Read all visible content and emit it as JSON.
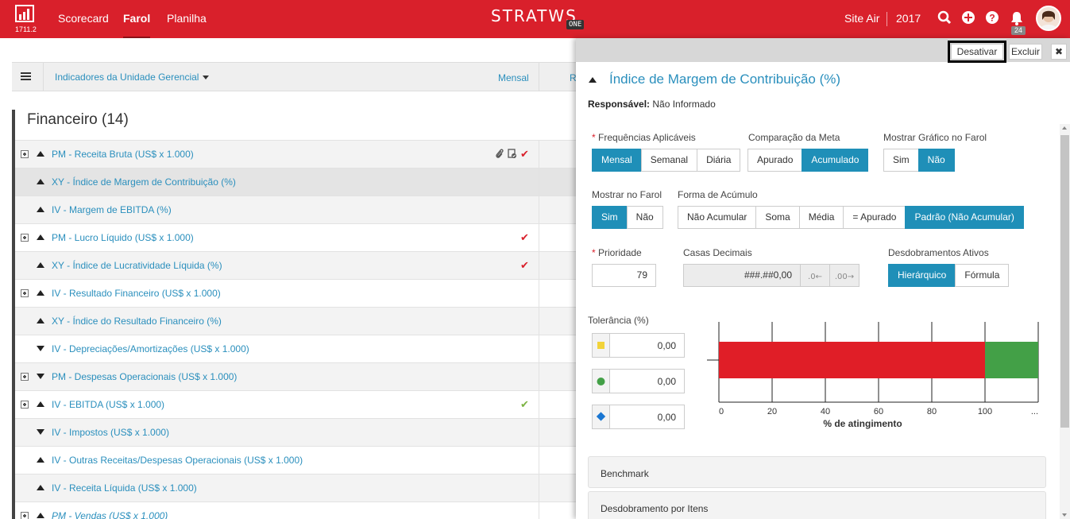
{
  "topbar": {
    "version": "1711.2",
    "nav": [
      "Scorecard",
      "Farol",
      "Planilha"
    ],
    "active_nav": "Farol",
    "brand": "STRATWS",
    "brand_suffix": "ONE",
    "company": "Site Air",
    "year": "2017",
    "notifications_count": "24",
    "icons": [
      "search-icon",
      "plus-circle-icon",
      "help-icon",
      "bell-icon"
    ]
  },
  "toolbar": {
    "title": "Indicadores da Unidade Gerencial",
    "frequency": "Mensal",
    "truncated_col": "R"
  },
  "group": {
    "title": "Financeiro (14)"
  },
  "rows": [
    {
      "label": "PM - Receita Bruta (US$ x 1.000)",
      "expand": true,
      "trend": "up",
      "check": "red",
      "icons": [
        "paperclip-icon",
        "document-check-icon"
      ]
    },
    {
      "label": "XY - Índice de Margem de Contribuição (%)",
      "expand": false,
      "trend": "up",
      "check": "",
      "selected": true
    },
    {
      "label": "IV - Margem de EBITDA (%)",
      "expand": false,
      "trend": "up",
      "check": ""
    },
    {
      "label": "PM - Lucro Líquido (US$ x 1.000)",
      "expand": true,
      "trend": "up",
      "check": "red"
    },
    {
      "label": "XY - Índice de Lucratividade Líquida (%)",
      "expand": false,
      "trend": "up",
      "check": "red"
    },
    {
      "label": "IV - Resultado Financeiro (US$ x 1.000)",
      "expand": true,
      "trend": "up",
      "check": ""
    },
    {
      "label": "XY - Índice do Resultado Financeiro (%)",
      "expand": false,
      "trend": "up",
      "check": ""
    },
    {
      "label": "IV - Depreciações/Amortizações (US$ x 1.000)",
      "expand": false,
      "trend": "down",
      "check": ""
    },
    {
      "label": "PM - Despesas Operacionais (US$ x 1.000)",
      "expand": true,
      "trend": "down",
      "check": ""
    },
    {
      "label": "IV - EBITDA (US$ x 1.000)",
      "expand": true,
      "trend": "up",
      "check": "green"
    },
    {
      "label": "IV - Impostos (US$ x 1.000)",
      "expand": false,
      "trend": "down",
      "check": ""
    },
    {
      "label": "IV - Outras Receitas/Despesas Operacionais (US$ x 1.000)",
      "expand": false,
      "trend": "up",
      "check": ""
    },
    {
      "label": "IV - Receita Líquida (US$ x 1.000)",
      "expand": false,
      "trend": "up",
      "check": ""
    },
    {
      "label": "PM - Vendas (US$ x 1.000)",
      "expand": true,
      "trend": "up",
      "check": "",
      "italic": true
    }
  ],
  "panel": {
    "buttons": {
      "deactivate": "Desativar",
      "delete": "Excluir",
      "close": "✖"
    },
    "title": "Índice de Margem de Contribuição (%)",
    "responsible_label": "Responsável:",
    "responsible_value": "Não Informado",
    "frequencies": {
      "label": "Frequências Aplicáveis",
      "required": "*",
      "options": [
        "Mensal",
        "Semanal",
        "Diária"
      ],
      "selected": "Mensal"
    },
    "goal_comparison": {
      "label": "Comparação da Meta",
      "options": [
        "Apurado",
        "Acumulado"
      ],
      "selected": "Acumulado"
    },
    "show_chart": {
      "label": "Mostrar Gráfico no Farol",
      "options": [
        "Sim",
        "Não"
      ],
      "selected": "Não"
    },
    "show_in_farol": {
      "label": "Mostrar no Farol",
      "options": [
        "Sim",
        "Não"
      ],
      "selected": "Sim"
    },
    "accumulation": {
      "label": "Forma de Acúmulo",
      "options": [
        "Não Acumular",
        "Soma",
        "Média",
        "= Apurado",
        "Padrão (Não Acumular)"
      ],
      "selected": "Padrão (Não Acumular)"
    },
    "priority": {
      "label": "Prioridade",
      "required": "*",
      "value": "79"
    },
    "decimals": {
      "label": "Casas Decimais",
      "value": "###.##0,00"
    },
    "breakdowns": {
      "label": "Desdobramentos Ativos",
      "options": [
        "Hierárquico",
        "Fórmula"
      ],
      "selected": "Hierárquico"
    },
    "tolerance": {
      "label": "Tolerância (%)",
      "values": [
        "0,00",
        "0,00",
        "0,00"
      ],
      "markers": [
        "yellow-square-icon",
        "green-circle-icon",
        "blue-diamond-icon"
      ]
    },
    "sections": [
      "Benchmark",
      "Desdobramento por Itens"
    ]
  },
  "chart_data": {
    "type": "bar",
    "orientation": "horizontal",
    "series": [
      {
        "name": "",
        "start": 0,
        "end": 100,
        "color": "#e01e27"
      },
      {
        "name": "",
        "start": 100,
        "end": 120,
        "color": "#43a047"
      }
    ],
    "ticks": [
      "0",
      "20",
      "40",
      "60",
      "80",
      "100",
      "..."
    ],
    "xlabel": "% de atingimento",
    "xlim": [
      0,
      120
    ]
  },
  "colors": {
    "brand_red": "#d9202b",
    "accent_blue": "#1f8fb8",
    "link_blue": "#2a8fbd"
  }
}
